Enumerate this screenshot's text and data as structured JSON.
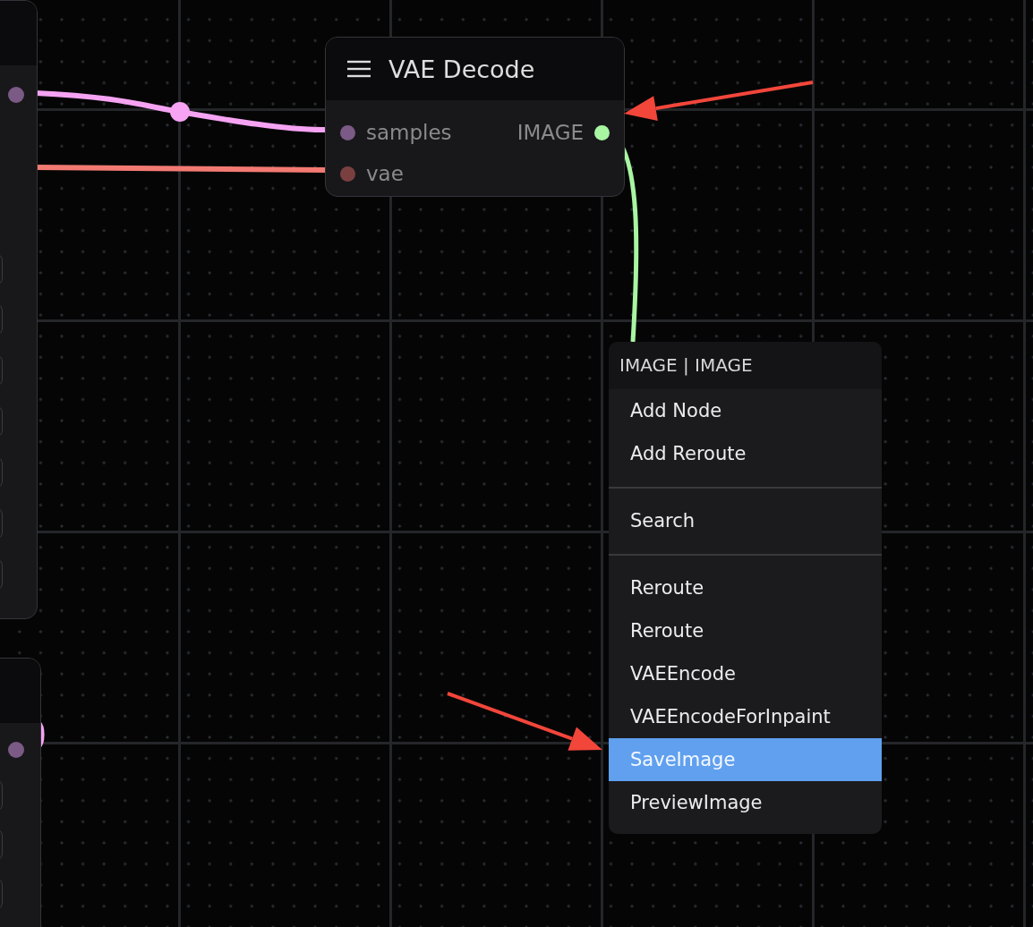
{
  "node": {
    "title": "VAE Decode",
    "inputs": [
      {
        "name": "samples",
        "color": "#7b5a85"
      },
      {
        "name": "vae",
        "color": "#7a4040"
      }
    ],
    "outputs": [
      {
        "name": "IMAGE",
        "color": "#a8f5a2"
      }
    ]
  },
  "context_menu": {
    "title": "IMAGE | IMAGE",
    "groups": [
      [
        {
          "label": "Add Node",
          "selected": false
        },
        {
          "label": "Add Reroute",
          "selected": false
        }
      ],
      [
        {
          "label": "Search",
          "selected": false
        }
      ],
      [
        {
          "label": "Reroute",
          "selected": false
        },
        {
          "label": "Reroute",
          "selected": false
        },
        {
          "label": "VAEEncode",
          "selected": false
        },
        {
          "label": "VAEEncodeForInpaint",
          "selected": false
        },
        {
          "label": "SaveImage",
          "selected": true
        },
        {
          "label": "PreviewImage",
          "selected": false
        }
      ]
    ]
  }
}
